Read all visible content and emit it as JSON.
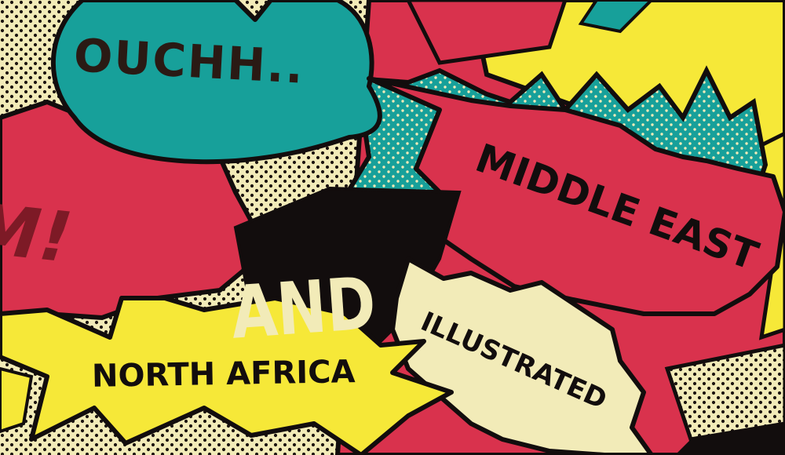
{
  "colors": {
    "red": "#d9324d",
    "teal": "#17a09a",
    "yellow": "#f6e838",
    "cream": "#f2ebb8",
    "black": "#120d0d",
    "ink": "#2a1a14"
  },
  "bubbles": {
    "ouchh": "OUCHH..",
    "boom_fragment": "OM!",
    "and": "AND",
    "middle_east": "MIDDLE EAST",
    "north_africa": "NORTH AFRICA",
    "illustrated": "ILLUSTRATED"
  }
}
